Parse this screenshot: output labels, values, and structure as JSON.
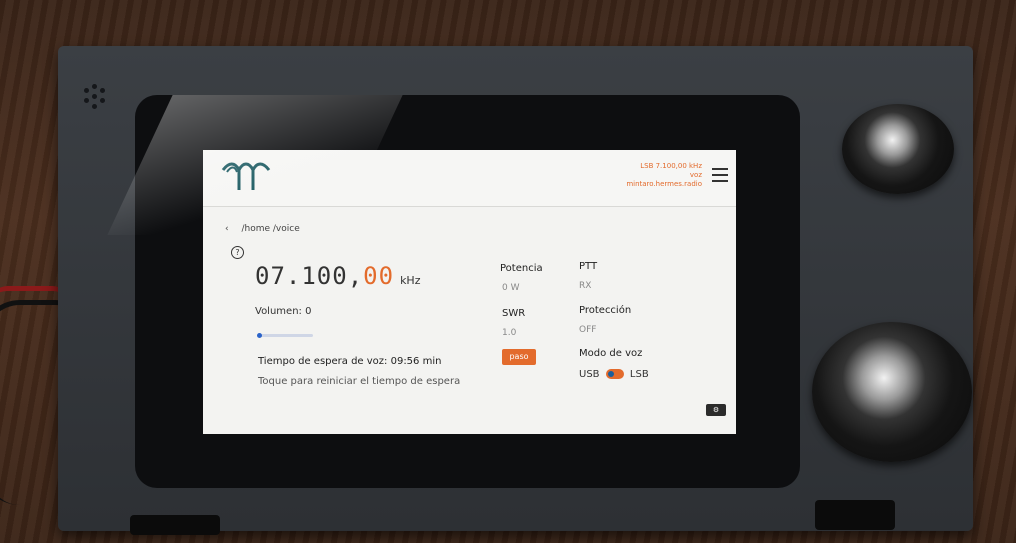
{
  "header": {
    "band_mode": "LSB 7.100,00 kHz",
    "mode": "voz",
    "host": "mintaro.hermes.radio"
  },
  "breadcrumb": {
    "back_icon": "‹",
    "path": "/home /voice"
  },
  "help_icon": "?",
  "frequency": {
    "prefix": "07.100,",
    "highlight": "00",
    "unit": "kHz"
  },
  "volume": {
    "label": "Volumen: 0",
    "level": 0
  },
  "timer": {
    "label": "Tiempo de espera de voz: 09:56 min",
    "reset_hint": "Toque para reiniciar el tiempo de espera"
  },
  "stats": {
    "potencia_label": "Potencia",
    "potencia_value": "0 W",
    "swr_label": "SWR",
    "swr_value": "1.0",
    "ptt_label": "PTT",
    "ptt_value": "RX",
    "proteccion_label": "Protección",
    "proteccion_value": "OFF"
  },
  "step_button": "paso",
  "voice_mode": {
    "label": "Modo de voz",
    "usb": "USB",
    "lsb": "LSB"
  },
  "settings_icon": "⚙",
  "colors": {
    "accent": "#e36b2c",
    "toggle_dot": "#1b5e9c"
  }
}
